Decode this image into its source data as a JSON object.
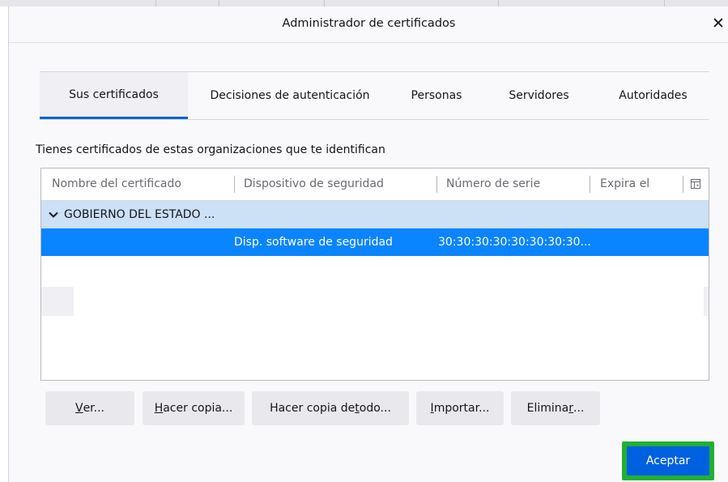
{
  "dialog": {
    "title": "Administrador de certificados",
    "close_glyph": "✕"
  },
  "tabs": [
    {
      "label": "Sus certificados",
      "selected": true
    },
    {
      "label": "Decisiones de autenticación",
      "selected": false
    },
    {
      "label": "Personas",
      "selected": false
    },
    {
      "label": "Servidores",
      "selected": false
    },
    {
      "label": "Autoridades",
      "selected": false
    }
  ],
  "description": "Tienes certificados de estas organizaciones que te identifican",
  "table": {
    "columns": [
      "Nombre del certificado",
      "Dispositivo de seguridad",
      "Número de serie",
      "Expira el"
    ],
    "column_picker_icon": "column-picker-icon",
    "group": {
      "name": "GOBIERNO DEL ESTADO ...",
      "expanded": true,
      "expander_icon": "chevron-down-icon"
    },
    "rows": [
      {
        "name": "",
        "device": "Disp. software de seguridad",
        "serial": "30:30:30:30:30:30:30:30...",
        "expires": "",
        "selected": true
      }
    ]
  },
  "buttons": {
    "view": {
      "pre": "",
      "key": "V",
      "post": "er..."
    },
    "backup": {
      "pre": "",
      "key": "H",
      "post": "acer copia..."
    },
    "backup_all": {
      "pre": "Hacer copia de ",
      "key": "t",
      "post": "odo..."
    },
    "import": {
      "pre": "",
      "key": "I",
      "post": "mportar..."
    },
    "delete": {
      "pre": "Elimina",
      "key": "r",
      "post": "..."
    }
  },
  "accept_label": "Aceptar",
  "colors": {
    "selected_row": "#0a84ff",
    "group_row": "#cce0f6",
    "tab_indicator": "#0060df",
    "accept_button": "#0061e0",
    "highlight_border": "#21b033"
  }
}
